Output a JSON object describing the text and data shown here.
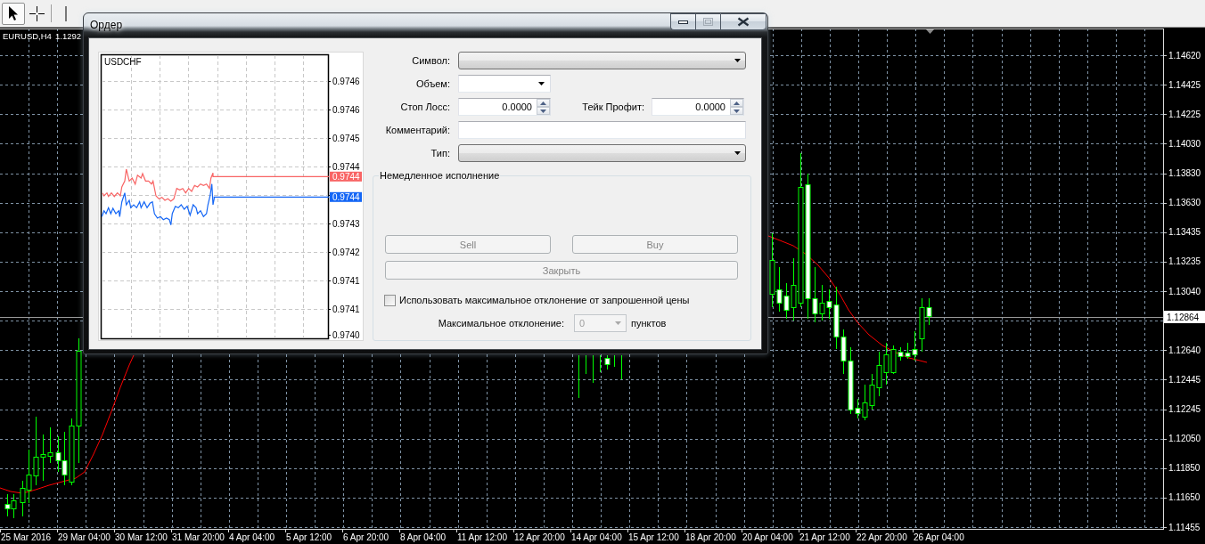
{
  "toolbar": {
    "tools": [
      {
        "kind": "cursor",
        "selected": true
      },
      {
        "kind": "crosshair",
        "selected": false
      },
      {
        "kind": "vertical_line",
        "selected": false
      }
    ]
  },
  "chart": {
    "symbol": "EURUSD,H4",
    "price": "1.1292",
    "price_labels": [
      "1.14620",
      "1.14425",
      "1.14225",
      "1.14030",
      "1.13830",
      "1.13630",
      "1.13435",
      "1.13235",
      "1.13040",
      "1.12640",
      "1.12445",
      "1.12245",
      "1.12050",
      "1.11850",
      "1.11650",
      "1.11455"
    ],
    "current_price": "1.12864",
    "time_labels": [
      "25 Mar 2016",
      "29 Mar 04:00",
      "30 Mar 12:00",
      "31 Mar 20:00",
      "4 Apr 04:00",
      "5 Apr 12:00",
      "6 Apr 20:00",
      "8 Apr 04:00",
      "11 Apr 12:00",
      "12 Apr 20:00",
      "14 Apr 04:00",
      "15 Apr 12:00",
      "18 Apr 20:00",
      "20 Apr 04:00",
      "21 Apr 12:00",
      "22 Apr 20:00",
      "26 Apr 04:00"
    ]
  },
  "order_dialog": {
    "title": "Ордер",
    "window_buttons": [
      {
        "kind": "minimize",
        "disabled": false
      },
      {
        "kind": "maximize",
        "disabled": true
      },
      {
        "kind": "close",
        "disabled": false
      }
    ],
    "tick_chart": {
      "symbol": "USDCHF",
      "price_labels": [
        "0.9746",
        "0.9746",
        "0.9745",
        "0.9744",
        "0.9743",
        "0.9742",
        "0.9741",
        "0.9741",
        "0.9740"
      ],
      "price_tags": [
        {
          "kind": "ask",
          "text": "0.9744",
          "color": "#f86464"
        },
        {
          "kind": "bid",
          "text": "0.9744",
          "color": "#1466f5"
        }
      ]
    },
    "symbol": {
      "label": "Символ:"
    },
    "volume": {
      "label": "Объем:"
    },
    "stop_loss": {
      "label": "Стоп Лосс:",
      "value": "0.0000"
    },
    "take_profit": {
      "label": "Тейк Профит:",
      "value": "0.0000"
    },
    "comment": {
      "label": "Комментарий:"
    },
    "order_type": {
      "label": "Тип:"
    },
    "execution": {
      "title": "Немедленное исполнение",
      "buttons": [
        {
          "label": "Sell",
          "disabled": true
        },
        {
          "label": "Buy",
          "disabled": true
        },
        {
          "label": "Закрыть",
          "disabled": true
        }
      ],
      "use_max_deviation": {
        "label": "Использовать максимальное отклонение от запрошенной цены",
        "checked": false
      },
      "max_deviation": {
        "label": "Максимальное отклонение:",
        "value": "0",
        "disabled": true,
        "unit": "пунктов"
      }
    }
  }
}
